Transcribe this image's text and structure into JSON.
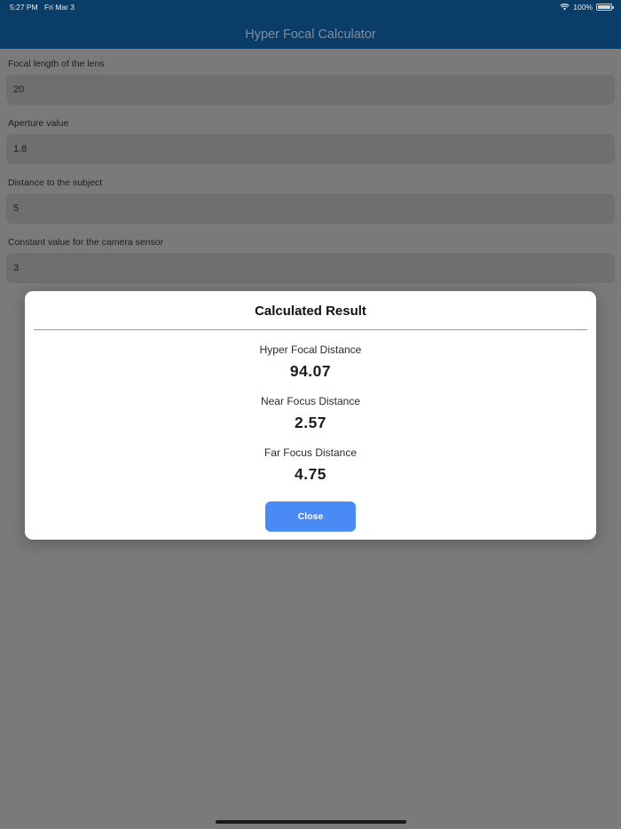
{
  "status_bar": {
    "time": "5:27 PM",
    "date": "Fri Mar 3",
    "battery": "100%"
  },
  "nav": {
    "title": "Hyper Focal Calculator"
  },
  "form": {
    "fields": [
      {
        "label": "Focal length of the lens",
        "value": "20"
      },
      {
        "label": "Aperture value",
        "value": "1.8"
      },
      {
        "label": "Distance to the subject",
        "value": "5"
      },
      {
        "label": "Constant value for the camera sensor",
        "value": "3"
      }
    ]
  },
  "dialog": {
    "title": "Calculated Result",
    "results": [
      {
        "label": "Hyper Focal Distance",
        "value": "94.07"
      },
      {
        "label": "Near Focus Distance",
        "value": "2.57"
      },
      {
        "label": "Far Focus Distance",
        "value": "4.75"
      }
    ],
    "close_label": "Close"
  },
  "colors": {
    "nav_bar": "#0b3d69",
    "accent": "#4a8af4",
    "overlay_background": "#7a7a7a"
  }
}
